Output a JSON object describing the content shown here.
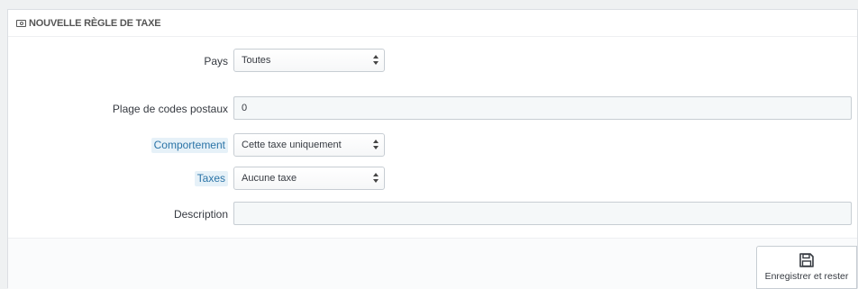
{
  "panel": {
    "heading": "NOUVELLE RÈGLE DE TAXE"
  },
  "form": {
    "country": {
      "label": "Pays",
      "value": "Toutes"
    },
    "zipcode": {
      "label": "Plage de codes postaux",
      "value": "0"
    },
    "behavior": {
      "label": "Comportement",
      "value": "Cette taxe uniquement"
    },
    "tax": {
      "label": "Taxes",
      "value": "Aucune taxe"
    },
    "description": {
      "label": "Description",
      "value": ""
    }
  },
  "footer": {
    "save_label": "Enregistrer et rester"
  },
  "icons": {
    "heading": "money-icon",
    "save": "floppy-disk-icon"
  },
  "colors": {
    "hint_bg": "#e6f1f8",
    "hint_text": "#2b74a7"
  }
}
